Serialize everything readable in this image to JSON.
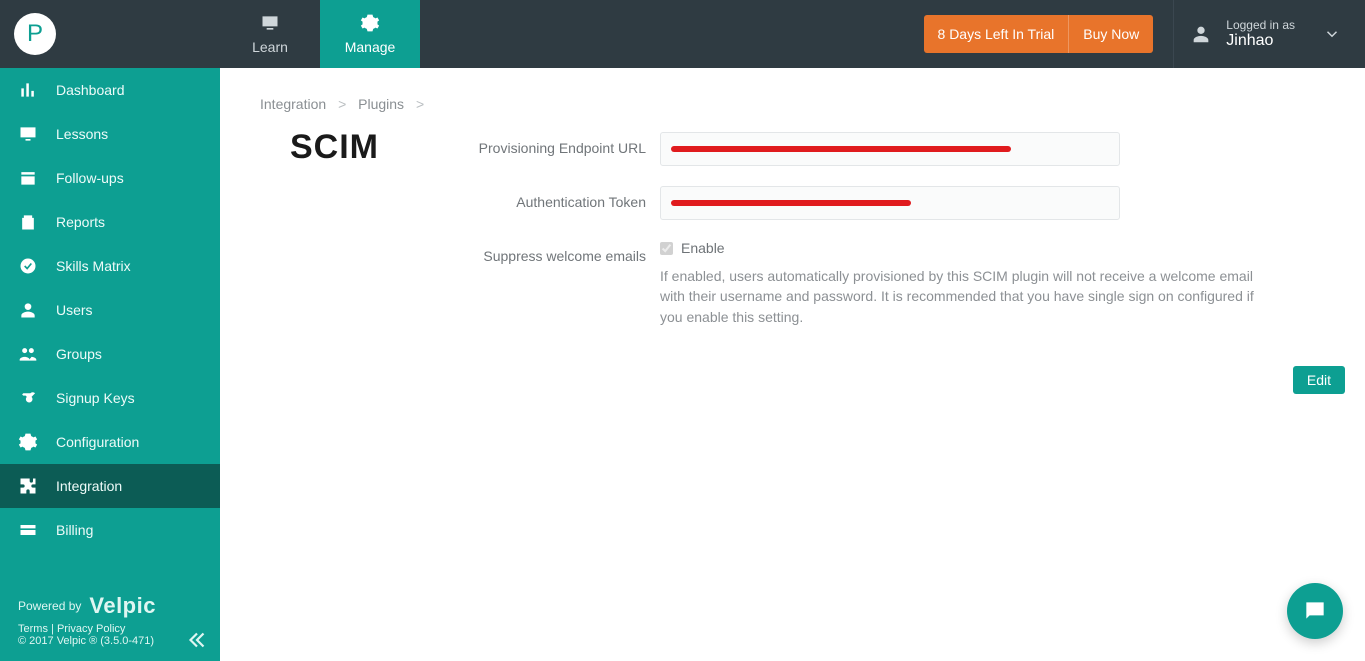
{
  "avatar_letter": "P",
  "tabs": {
    "learn": "Learn",
    "manage": "Manage"
  },
  "trial": {
    "message": "8 Days Left In Trial",
    "buy": "Buy Now"
  },
  "user": {
    "label": "Logged in as",
    "name": "Jinhao"
  },
  "sidebar": {
    "items": [
      {
        "label": "Dashboard"
      },
      {
        "label": "Lessons"
      },
      {
        "label": "Follow-ups"
      },
      {
        "label": "Reports"
      },
      {
        "label": "Skills Matrix"
      },
      {
        "label": "Users"
      },
      {
        "label": "Groups"
      },
      {
        "label": "Signup Keys"
      },
      {
        "label": "Configuration"
      },
      {
        "label": "Integration"
      },
      {
        "label": "Billing"
      }
    ],
    "powered_by": "Powered by",
    "brand": "Velpic",
    "terms": "Terms",
    "privacy": "Privacy Policy",
    "copyright": "© 2017 Velpic ® (3.5.0-471)"
  },
  "breadcrumb": {
    "a": "Integration",
    "b": "Plugins"
  },
  "plugin_logo": "SCIM",
  "form": {
    "endpoint_label": "Provisioning Endpoint URL",
    "token_label": "Authentication Token",
    "suppress_label": "Suppress welcome emails",
    "enable_label": "Enable",
    "help": "If enabled, users automatically provisioned by this SCIM plugin will not receive a welcome email with their username and password. It is recommended that you have single sign on configured if you enable this setting."
  },
  "edit_button": "Edit"
}
